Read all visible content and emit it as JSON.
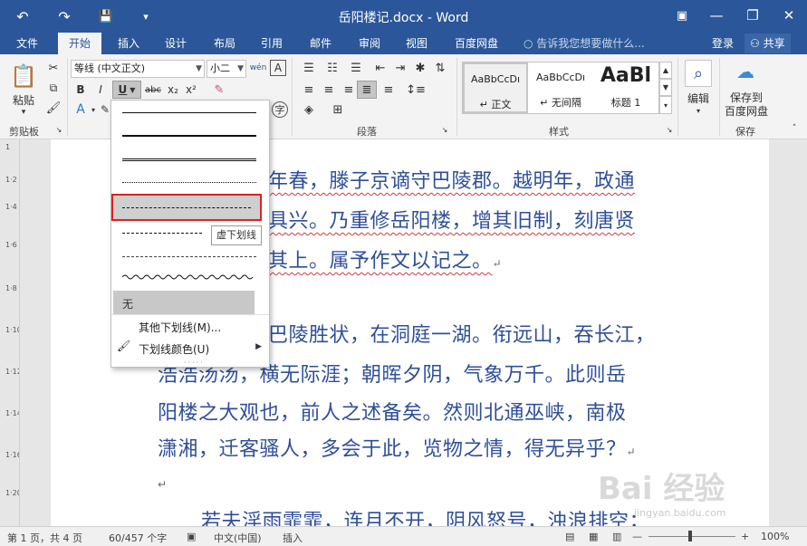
{
  "titlebar": {
    "title": "岳阳楼记.docx - Word",
    "undo_icon": "↶",
    "redo_icon": "↷",
    "save_icon": "💾",
    "customize_icon": "▾",
    "ribbon_display_icon": "▣",
    "minimize_icon": "—",
    "restore_icon": "❐",
    "close_icon": "✕"
  },
  "tabs": {
    "items": [
      "文件",
      "开始",
      "插入",
      "设计",
      "布局",
      "引用",
      "邮件",
      "审阅",
      "视图",
      "百度网盘"
    ],
    "active": "开始",
    "tell_me": "告诉我您想要做什么...",
    "login": "登录",
    "share": "共享"
  },
  "ribbon": {
    "clipboard": {
      "paste_label": "粘贴",
      "group": "剪贴板"
    },
    "font": {
      "font_name": "等线 (中文正文)",
      "font_size": "小二",
      "bold": "B",
      "italic": "I",
      "underline": "U",
      "strike": "abc",
      "subscript": "x₂",
      "superscript": "x²",
      "phonetic": "wén",
      "char_border": "A"
    },
    "paragraph": {
      "group": "段落"
    },
    "styles": {
      "group": "样式",
      "items": [
        {
          "preview": "AaBbCcDı",
          "name": "↵ 正文"
        },
        {
          "preview": "AaBbCcDı",
          "name": "↵ 无间隔"
        },
        {
          "preview": "AaBl",
          "name": "标题 1"
        }
      ]
    },
    "editing": {
      "label": "编辑"
    },
    "save": {
      "label1": "保存到",
      "label2": "百度网盘",
      "group": "保存"
    }
  },
  "document": {
    "lines": [
      "年春，滕子京谪守巴陵郡。越明年，政通",
      "具兴。乃重修岳阳楼，增其旧制，刻唐贤",
      "其上。属予作文以记之。",
      "巴陵胜状，在洞庭一湖。衔远山，吞长江，",
      "浩浩汤汤，横无际涯；朝晖夕阴，气象万千。此则岳",
      "阳楼之大观也，前人之述备矣。然则北通巫峡，南极",
      "潇湘，迁客骚人，多会于此，览物之情，得无异乎？",
      "若夫淫雨霏霏，连月不开，阴风怒号，浊浪排空；"
    ],
    "para_mark": "↵"
  },
  "underline_menu": {
    "none_label": "无",
    "more_label": "其他下划线(M)...",
    "color_label": "下划线颜色(U)",
    "tooltip": "虚下划线"
  },
  "statusbar": {
    "page": "第 1 页，共 4 页",
    "words": "60/457 个字",
    "language": "中文(中国)",
    "mode": "插入",
    "zoom": "100%"
  },
  "watermark": {
    "brand": "Bai 经验",
    "url": "jingyan.baidu.com"
  },
  "colors": {
    "accent": "#2b579a",
    "text_blue": "#2f4f9a",
    "highlight_red": "#e02020"
  }
}
